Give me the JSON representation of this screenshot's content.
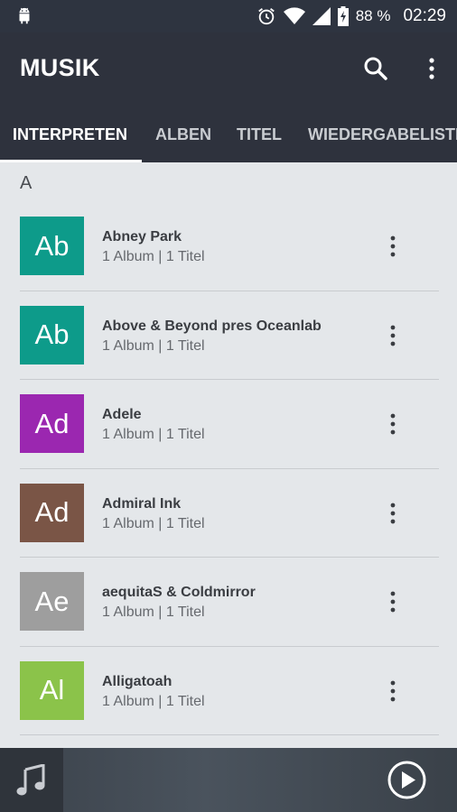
{
  "status_bar": {
    "battery_percent": "88 %",
    "time": "02:29",
    "icons": [
      "android-icon",
      "alarm-icon",
      "wifi-icon",
      "signal-icon",
      "battery-charging-icon"
    ]
  },
  "app_bar": {
    "title": "MUSIK",
    "icons": [
      "search-icon",
      "more-vert-icon"
    ]
  },
  "tabs": [
    {
      "label": "INTERPRETEN",
      "active": true
    },
    {
      "label": "ALBEN",
      "active": false
    },
    {
      "label": "TITEL",
      "active": false
    },
    {
      "label": "WIEDERGABELISTE",
      "active": false
    }
  ],
  "section_letter": "A",
  "artists": [
    {
      "initials": "Ab",
      "name": "Abney Park",
      "meta": "1 Album | 1 Titel",
      "color": "#0d9b8a"
    },
    {
      "initials": "Ab",
      "name": "Above & Beyond pres Oceanlab",
      "meta": "1 Album | 1 Titel",
      "color": "#0d9b8a"
    },
    {
      "initials": "Ad",
      "name": "Adele",
      "meta": "1 Album | 1 Titel",
      "color": "#9b27b0"
    },
    {
      "initials": "Ad",
      "name": "Admiral Ink",
      "meta": "1 Album | 1 Titel",
      "color": "#7a5546"
    },
    {
      "initials": "Ae",
      "name": "aequitaS & Coldmirror",
      "meta": "1 Album | 1 Titel",
      "color": "#9e9e9e"
    },
    {
      "initials": "Al",
      "name": "Alligatoah",
      "meta": "1 Album | 1 Titel",
      "color": "#8bc34a"
    }
  ],
  "player": {
    "icons": [
      "music-note-icon",
      "play-icon"
    ]
  },
  "colors": {
    "app_bar": "#2e323d",
    "background": "#e4e7ea"
  }
}
